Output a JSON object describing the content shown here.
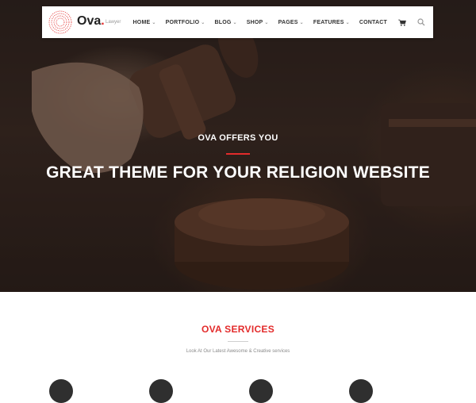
{
  "brand": {
    "name": "Ova",
    "dot": ".",
    "tagline": "Lawyer"
  },
  "nav": {
    "items": [
      {
        "label": "HOME",
        "has_dropdown": true
      },
      {
        "label": "PORTFOLIO",
        "has_dropdown": true
      },
      {
        "label": "BLOG",
        "has_dropdown": true
      },
      {
        "label": "SHOP",
        "has_dropdown": true
      },
      {
        "label": "PAGES",
        "has_dropdown": true
      },
      {
        "label": "FEATURES",
        "has_dropdown": true
      },
      {
        "label": "CONTACT",
        "has_dropdown": false
      }
    ],
    "dropdown_glyph": "⌄",
    "cart_icon": "cart-icon",
    "search_icon": "search-icon"
  },
  "hero": {
    "subtitle": "OVA OFFERS YOU",
    "title": "GREAT THEME FOR YOUR RELIGION WEBSITE"
  },
  "services": {
    "title": "OVA SERVICES",
    "description": "Look At Our Latest Awesome & Creative services",
    "icon_count": 4
  },
  "colors": {
    "accent": "#e32b2b",
    "text_dark": "#222222",
    "hero_text": "#ffffff"
  }
}
